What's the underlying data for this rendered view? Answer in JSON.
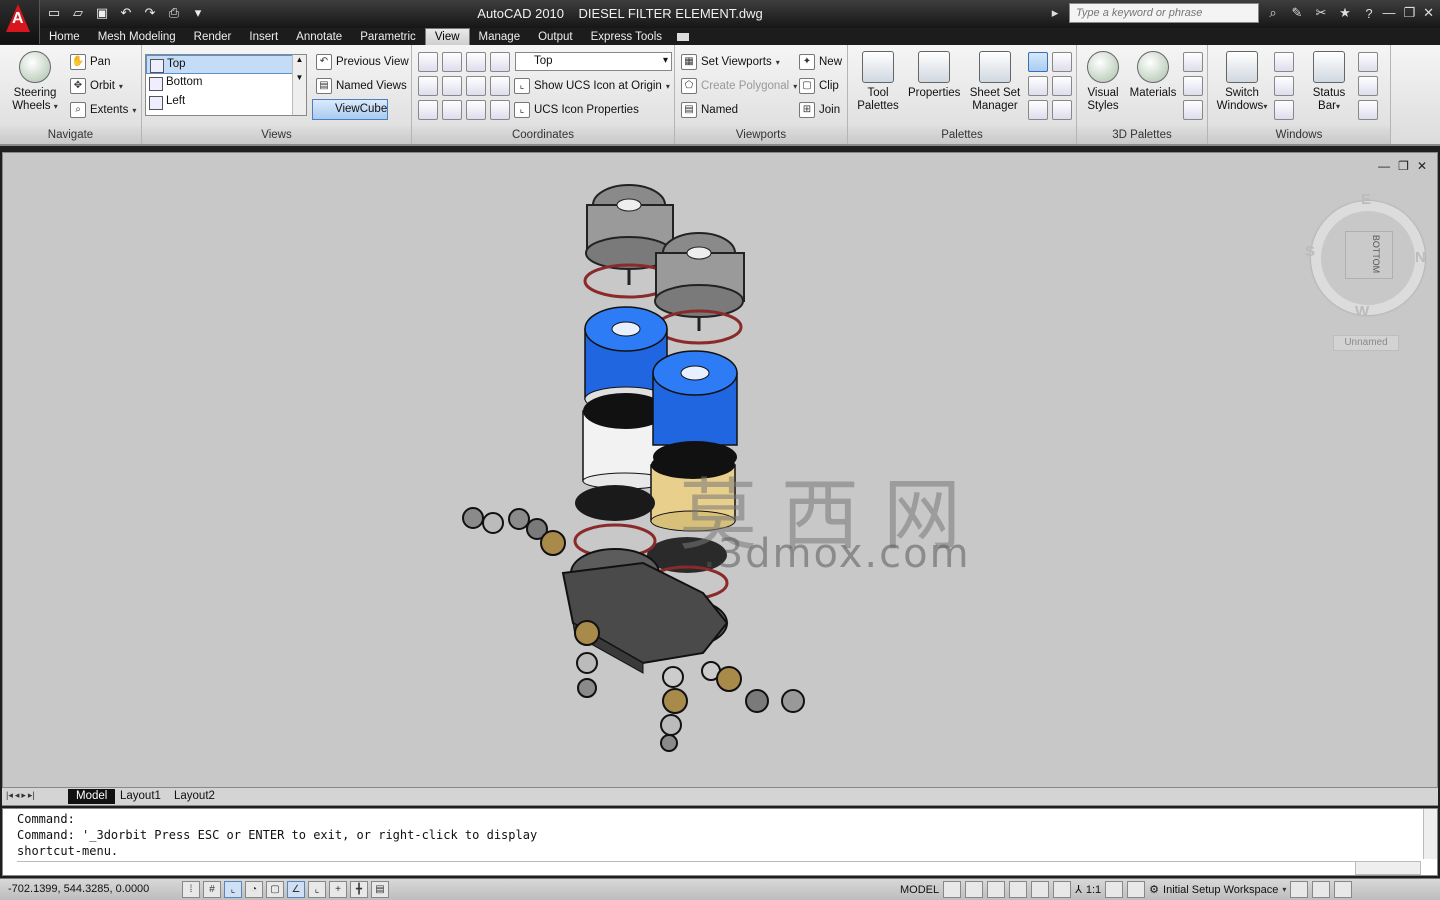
{
  "title": {
    "app": "AutoCAD 2010",
    "file": "DIESEL FILTER ELEMENT.dwg",
    "search_placeholder": "Type a keyword or phrase"
  },
  "ribbon_tabs": [
    "Home",
    "Mesh Modeling",
    "Render",
    "Insert",
    "Annotate",
    "Parametric",
    "View",
    "Manage",
    "Output",
    "Express Tools"
  ],
  "active_tab": "View",
  "panels": {
    "navigate": {
      "title": "Navigate",
      "steering_wheels": "Steering Wheels",
      "pan": "Pan",
      "orbit": "Orbit",
      "extents": "Extents"
    },
    "views": {
      "title": "Views",
      "list": [
        "Top",
        "Bottom",
        "Left"
      ],
      "previous_view": "Previous View",
      "named_views": "Named Views",
      "viewcube": "ViewCube"
    },
    "coordinates": {
      "title": "Coordinates",
      "ucs_combo": "Top",
      "show_ucs_icon": "Show UCS Icon at Origin",
      "ucs_icon_properties": "UCS Icon Properties"
    },
    "viewports": {
      "title": "Viewports",
      "set_viewports": "Set Viewports",
      "create_polygonal": "Create Polygonal",
      "named": "Named",
      "new": "New",
      "clip": "Clip",
      "join": "Join"
    },
    "palettes": {
      "title": "Palettes",
      "tool_palettes": "Tool Palettes",
      "properties": "Properties",
      "sheet_set_manager": "Sheet Set Manager"
    },
    "palettes3d": {
      "title": "3D Palettes",
      "visual_styles": "Visual Styles",
      "materials": "Materials"
    },
    "windows": {
      "title": "Windows",
      "switch_windows": "Switch Windows",
      "status_bar": "Status Bar"
    }
  },
  "viewcube": {
    "face": "BOTTOM",
    "north": "N",
    "south": "S",
    "east": "E",
    "west": "W",
    "ucs_label": "Unnamed"
  },
  "watermark": {
    "cn": "莫西网",
    "url": ".3dmox.com"
  },
  "layout_tabs": [
    "Model",
    "Layout1",
    "Layout2"
  ],
  "active_layout": "Model",
  "command_lines": [
    "Command:",
    "Command: '_3dorbit Press ESC or ENTER to exit, or right-click to display",
    "shortcut-menu."
  ],
  "status": {
    "coordinates": "-702.1399, 544.3285, 0.0000",
    "space": "MODEL",
    "annotation_scale": "1:1",
    "workspace": "Initial Setup Workspace"
  }
}
